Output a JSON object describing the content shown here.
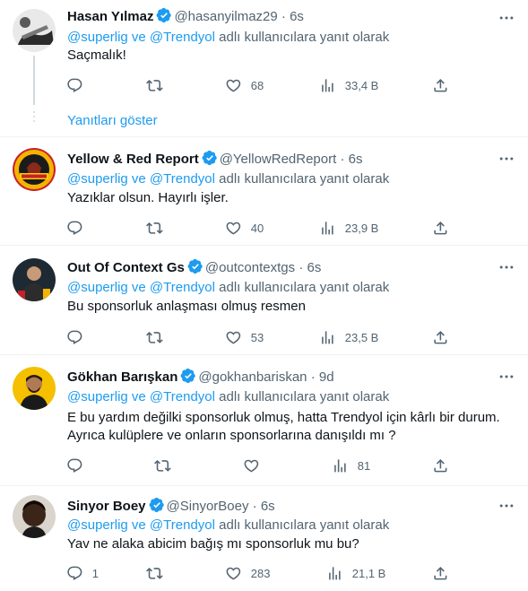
{
  "tweets": [
    {
      "name": "Hasan Yılmaz",
      "handle": "@hasanyilmaz29",
      "dot": "·",
      "time": "6s",
      "mentions": "@superlig ve @Trendyol",
      "reply_suffix": "adlı kullanıcılara yanıt olarak",
      "lines": [
        "Saçmalık!"
      ],
      "replies": "",
      "retweets": "",
      "likes": "68",
      "views": "33,4 B",
      "show_replies": "Yanıtları göster"
    },
    {
      "name": "Yellow & Red Report",
      "handle": "@YellowRedReport",
      "dot": "·",
      "time": "6s",
      "mentions": "@superlig ve @Trendyol",
      "reply_suffix": "adlı kullanıcılara yanıt olarak",
      "lines": [
        "Yazıklar olsun. Hayırlı işler."
      ],
      "replies": "",
      "retweets": "",
      "likes": "40",
      "views": "23,9 B"
    },
    {
      "name": "Out Of Context Gs",
      "handle": "@outcontextgs",
      "dot": "·",
      "time": "6s",
      "mentions": "@superlig ve @Trendyol",
      "reply_suffix": "adlı kullanıcılara yanıt olarak",
      "lines": [
        "Bu sponsorluk anlaşması olmuş resmen"
      ],
      "replies": "",
      "retweets": "",
      "likes": "53",
      "views": "23,5 B"
    },
    {
      "name": "Gökhan Barışkan",
      "handle": "@gokhanbariskan",
      "dot": "·",
      "time": "9d",
      "mentions": "@superlig ve @Trendyol",
      "reply_suffix": "adlı kullanıcılara yanıt olarak",
      "lines": [
        "E bu yardım değilki sponsorluk olmuş, hatta Trendyol için kârlı bir durum.",
        "Ayrıca kulüplere ve onların sponsorlarına danışıldı mı ?"
      ],
      "replies": "",
      "retweets": "",
      "likes": "",
      "views": "81"
    },
    {
      "name": "Sinyor Boey",
      "handle": "@SinyorBoey",
      "dot": "·",
      "time": "6s",
      "mentions": "@superlig ve @Trendyol",
      "reply_suffix": "adlı kullanıcılara yanıt olarak",
      "lines": [
        "Yav ne alaka abicim bağış mı sponsorluk mu bu?"
      ],
      "replies": "1",
      "retweets": "",
      "likes": "283",
      "views": "21,1 B"
    }
  ],
  "colors": {
    "accent": "#1d9bf0",
    "muted": "#536471",
    "text": "#0f1419",
    "border": "#eff3f4"
  },
  "icons": [
    "reply-icon",
    "retweet-icon",
    "like-icon",
    "views-icon",
    "share-icon",
    "more-icon",
    "verified-badge-icon"
  ]
}
